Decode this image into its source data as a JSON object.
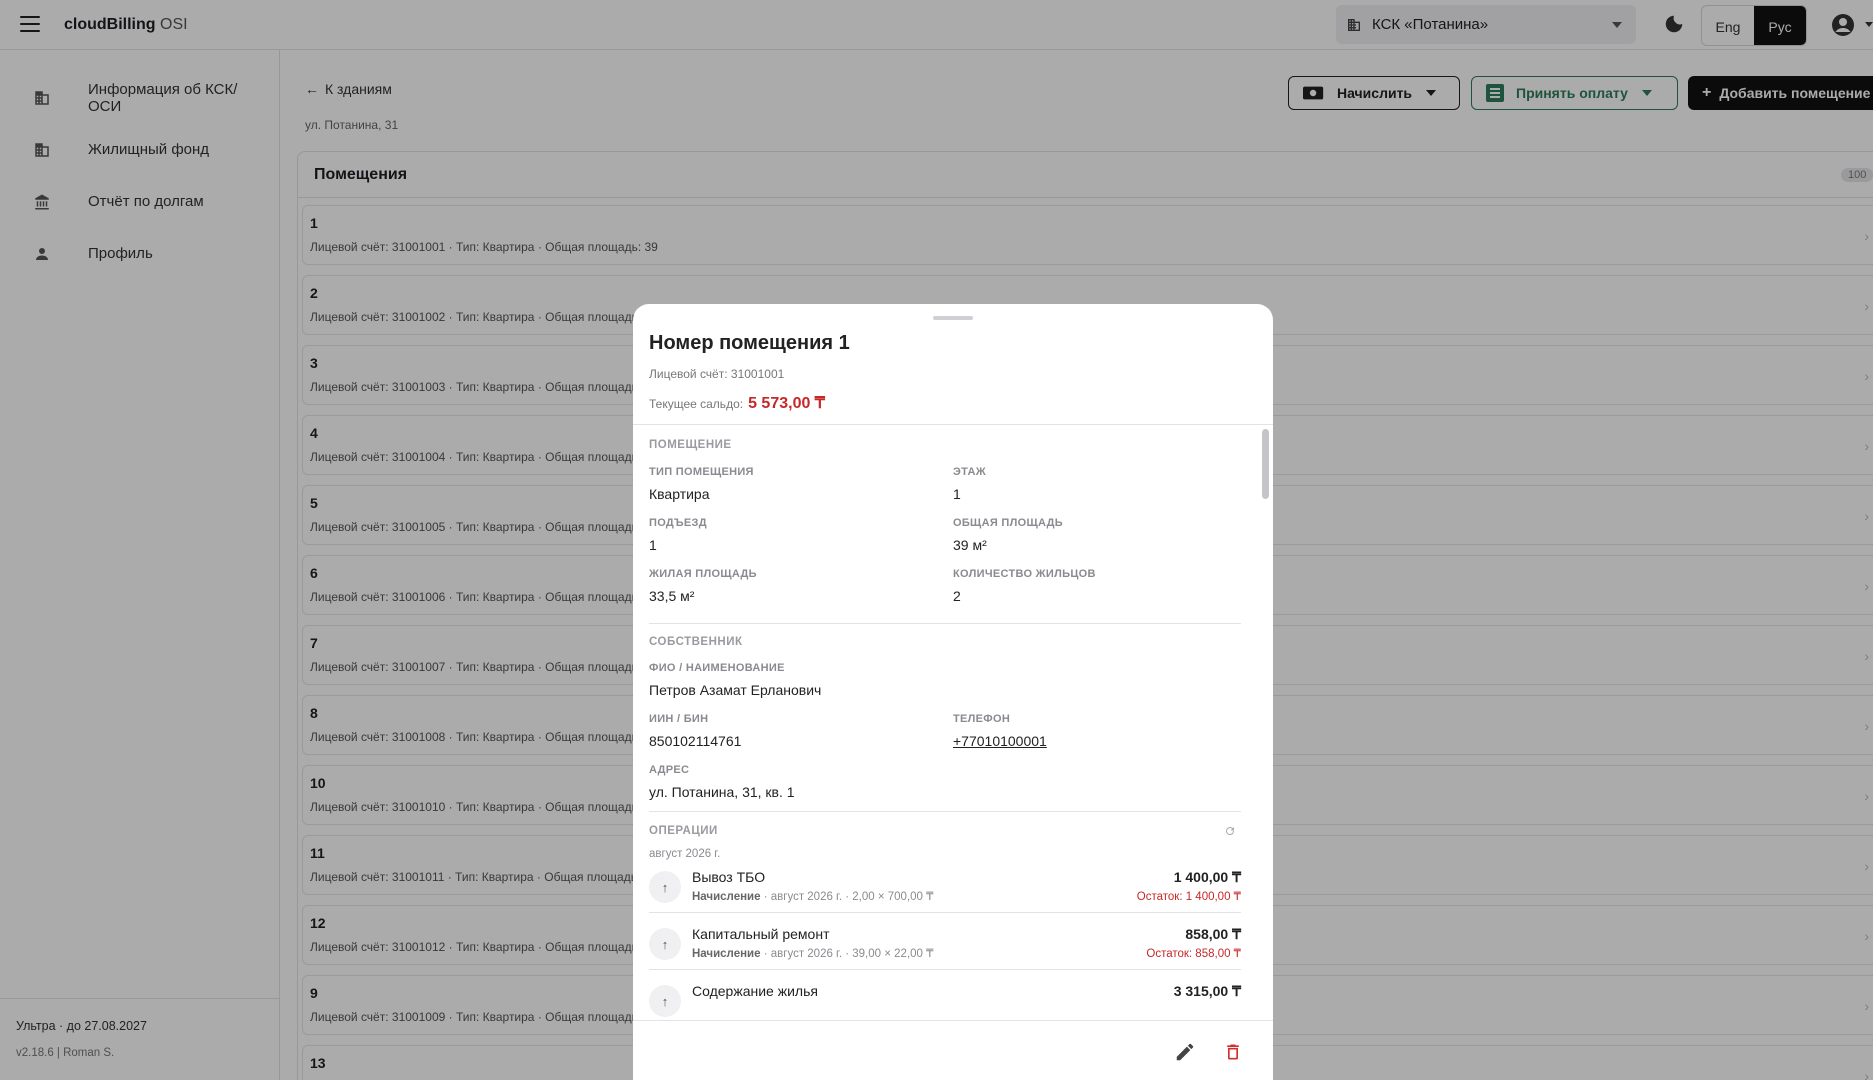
{
  "header": {
    "brand": "cloudBilling",
    "brand_sub": "OSI",
    "ksk_select": "КСК «Потанина»",
    "lang_eng": "Eng",
    "lang_rus": "Рус"
  },
  "sidebar": {
    "items": [
      {
        "label": "Информация об КСК/ ОСИ",
        "icon": "building-icon"
      },
      {
        "label": "Жилищный фонд",
        "icon": "apartment-icon"
      },
      {
        "label": "Отчёт по долгам",
        "icon": "bank-icon"
      },
      {
        "label": "Профиль",
        "icon": "person-icon"
      }
    ],
    "plan": "Ультра · до 27.08.2027",
    "version": "v2.18.6 | Roman S."
  },
  "main": {
    "back": "К зданиям",
    "address": "ул. Потанина, 31",
    "buttons": {
      "charge": "Начислить",
      "pay": "Принять оплату",
      "add": "Добавить помещение"
    },
    "panel_title": "Помещения",
    "count": "100",
    "rows": [
      {
        "num": "1",
        "meta": "Лицевой счёт: 31001001 · Тип: Квартира · Общая площадь: 39"
      },
      {
        "num": "2",
        "meta": "Лицевой счёт: 31001002 · Тип: Квартира · Общая площадь"
      },
      {
        "num": "3",
        "meta": "Лицевой счёт: 31001003 · Тип: Квартира · Общая площадь"
      },
      {
        "num": "4",
        "meta": "Лицевой счёт: 31001004 · Тип: Квартира · Общая площадь"
      },
      {
        "num": "5",
        "meta": "Лицевой счёт: 31001005 · Тип: Квартира · Общая площадь"
      },
      {
        "num": "6",
        "meta": "Лицевой счёт: 31001006 · Тип: Квартира · Общая площадь"
      },
      {
        "num": "7",
        "meta": "Лицевой счёт: 31001007 · Тип: Квартира · Общая площадь"
      },
      {
        "num": "8",
        "meta": "Лицевой счёт: 31001008 · Тип: Квартира · Общая площадь"
      },
      {
        "num": "10",
        "meta": "Лицевой счёт: 31001010 · Тип: Квартира · Общая площадь"
      },
      {
        "num": "11",
        "meta": "Лицевой счёт: 31001011 · Тип: Квартира · Общая площадь"
      },
      {
        "num": "12",
        "meta": "Лицевой счёт: 31001012 · Тип: Квартира · Общая площадь"
      },
      {
        "num": "9",
        "meta": "Лицевой счёт: 31001009 · Тип: Квартира · Общая площадь"
      },
      {
        "num": "13",
        "meta": ""
      }
    ]
  },
  "modal": {
    "title": "Номер помещения 1",
    "account": "Лицевой счёт: 31001001",
    "balance_label": "Текущее сальдо:",
    "balance": "5 573,00 ₸",
    "sec_room": "ПОМЕЩЕНИЕ",
    "type_l": "ТИП ПОМЕЩЕНИЯ",
    "type_v": "Квартира",
    "floor_l": "ЭТАЖ",
    "floor_v": "1",
    "entr_l": "ПОДЪЕЗД",
    "entr_v": "1",
    "area_l": "ОБЩАЯ ПЛОЩАДЬ",
    "area_v": "39 м²",
    "live_l": "ЖИЛАЯ ПЛОЩАДЬ",
    "live_v": "33,5 м²",
    "res_l": "КОЛИЧЕСТВО ЖИЛЬЦОВ",
    "res_v": "2",
    "sec_owner": "СОБСТВЕННИК",
    "fio_l": "ФИО / НАИМЕНОВАНИЕ",
    "fio_v": "Петров Азамат Ерланович",
    "iin_l": "ИИН / БИН",
    "iin_v": "850102114761",
    "tel_l": "ТЕЛЕФОН",
    "tel_v": "+77010100001",
    "addr_l": "АДРЕС",
    "addr_v": "ул. Потанина, 31, кв. 1",
    "sec_ops": "ОПЕРАЦИИ",
    "month": "август 2026 г.",
    "ops": [
      {
        "name": "Вывоз ТБО",
        "kind": "Начисление",
        "detail": " · август 2026 г. · 2,00 × 700,00 ₸",
        "amount": "1 400,00 ₸",
        "rest": "Остаток: 1 400,00 ₸"
      },
      {
        "name": "Капитальный ремонт",
        "kind": "Начисление",
        "detail": " · август 2026 г. · 39,00 × 22,00 ₸",
        "amount": "858,00 ₸",
        "rest": "Остаток: 858,00 ₸"
      },
      {
        "name": "Содержание жилья",
        "kind": "",
        "detail": "",
        "amount": "3 315,00 ₸",
        "rest": ""
      }
    ]
  },
  "colors": {
    "accent_red": "#c62828",
    "accent_green": "#2e7d5b",
    "dark": "#111111"
  }
}
